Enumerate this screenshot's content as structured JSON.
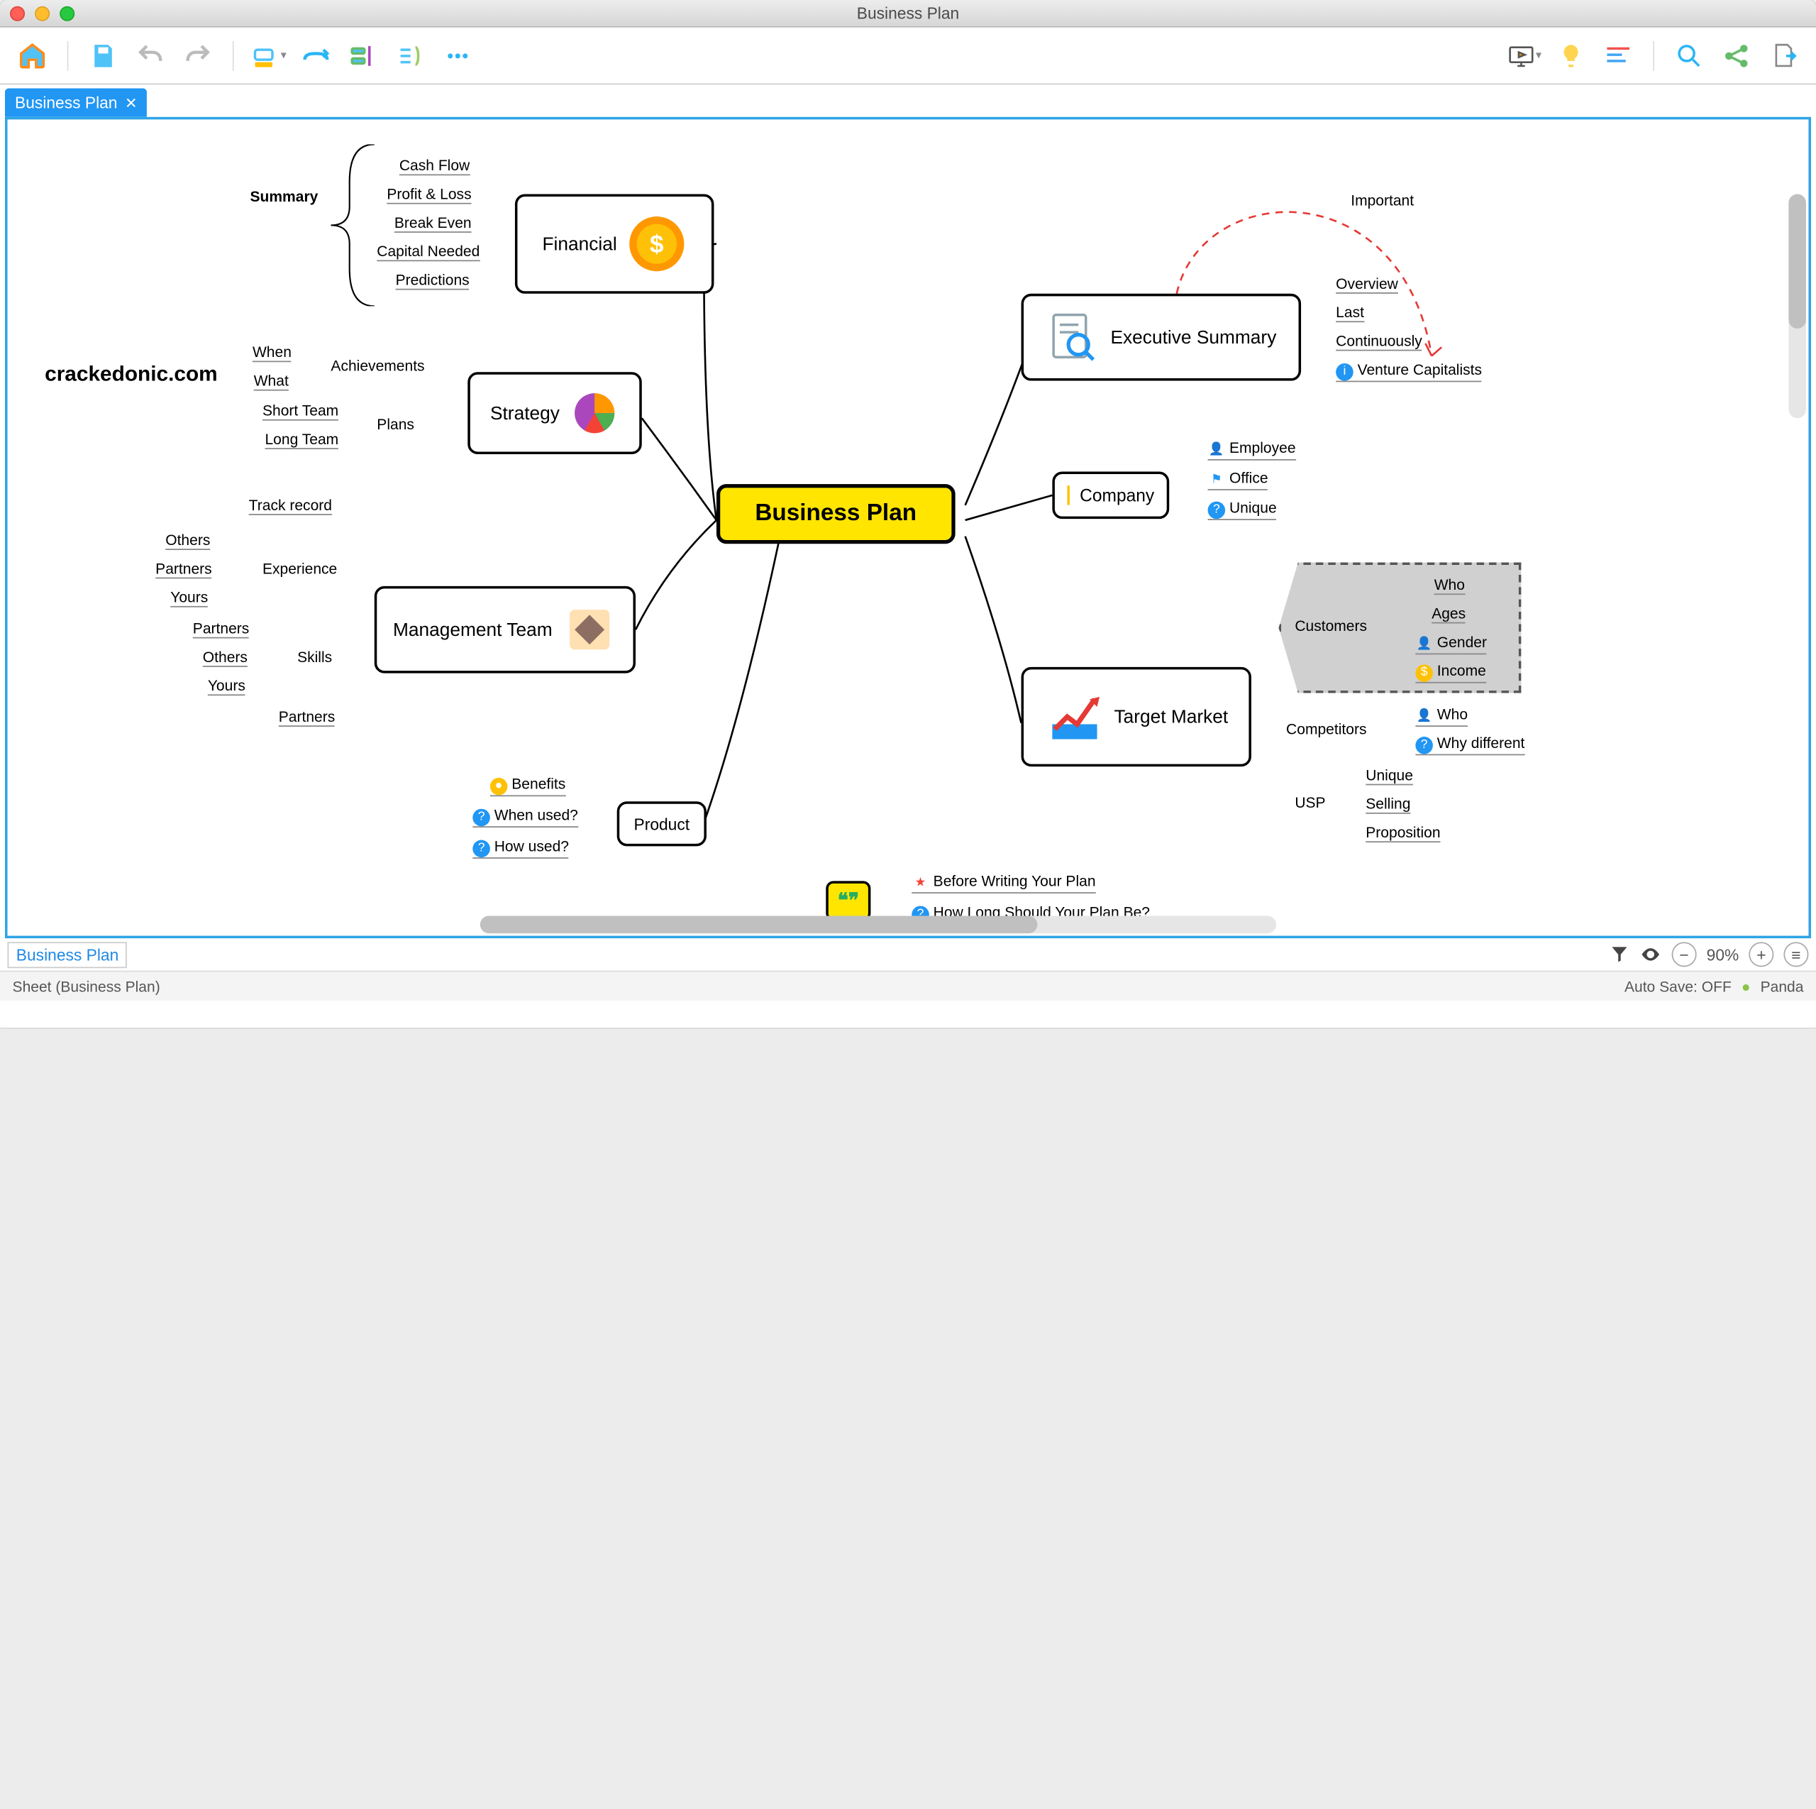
{
  "window_title": "Business Plan",
  "tab_label": "Business Plan",
  "watermark": "crackedonic.com",
  "central": "Business Plan",
  "summary_label": "Summary",
  "branches": {
    "financial": {
      "label": "Financial",
      "items": [
        "Cash Flow",
        "Profit & Loss",
        "Break Even",
        "Capital Needed",
        "Predictions"
      ]
    },
    "strategy": {
      "label": "Strategy",
      "groups": [
        {
          "label": "Achievements",
          "items": [
            "When",
            "What"
          ]
        },
        {
          "label": "Plans",
          "items": [
            "Short Team",
            "Long Team"
          ]
        }
      ]
    },
    "management": {
      "label": "Management Team",
      "groups": [
        {
          "label": "Track record",
          "items": []
        },
        {
          "label": "Experience",
          "items": [
            "Others",
            "Partners",
            "Yours"
          ]
        },
        {
          "label": "Skills",
          "items": [
            "Partners",
            "Others",
            "Yours"
          ]
        },
        {
          "label": "Partners",
          "items": []
        }
      ]
    },
    "product": {
      "label": "Product",
      "items": [
        "Benefits",
        "When used?",
        "How used?"
      ]
    },
    "exec": {
      "label": "Executive Summary",
      "items": [
        "Overview",
        "Last",
        "Continuously",
        "Venture Capitalists"
      ],
      "rel_label": "Important"
    },
    "company": {
      "label": "Company",
      "items": [
        "Employee",
        "Office",
        "Unique"
      ]
    },
    "target": {
      "label": "Target Market",
      "groups": [
        {
          "label": "Customers",
          "items": [
            "Who",
            "Ages",
            "Gender",
            "Income"
          ]
        },
        {
          "label": "Competitors",
          "items": [
            "Who",
            "Why different"
          ]
        },
        {
          "label": "USP",
          "items": [
            "Unique",
            "Selling",
            "Proposition"
          ]
        }
      ]
    },
    "floating_items": [
      "Before Writing Your Plan",
      "How Long Should Your Plan Be?"
    ]
  },
  "sheet_tab": "Business Plan",
  "sheet_status": "Sheet (Business Plan)",
  "zoom": "90%",
  "autosave": "Auto Save: OFF",
  "user": "Panda"
}
